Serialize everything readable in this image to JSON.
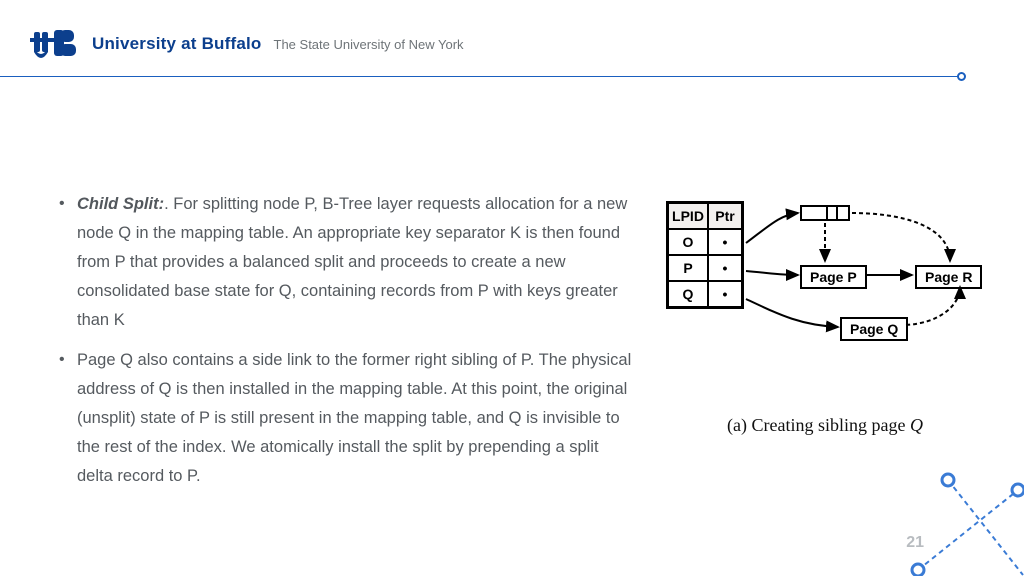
{
  "header": {
    "university_name": "University at Buffalo",
    "subtitle": "The State University of New York"
  },
  "bullets": [
    {
      "lead": "Child Split:",
      "text": ". For splitting node P, B-Tree layer requests allocation for a new node Q in the mapping table. An appropriate key separator K is then found from P that provides a balanced split and proceeds to create a new consolidated base state for Q, containing records from P with keys greater than K"
    },
    {
      "lead": "",
      "text": "Page Q also contains a side link to the former right sibling of P. The physical address of Q is then installed in the mapping table. At this point, the original (unsplit) state of P is still present in the mapping table, and Q is invisible to the rest of the index. We atomically install the split by prepending a split delta record to P."
    }
  ],
  "diagram": {
    "table_headers": [
      "LPID",
      "Ptr"
    ],
    "table_rows": [
      "O",
      "P",
      "Q"
    ],
    "page_p": "Page P",
    "page_q": "Page Q",
    "page_r": "Page R",
    "caption_prefix": "(a) Creating sibling page ",
    "caption_var": "Q"
  },
  "page_number": "21"
}
